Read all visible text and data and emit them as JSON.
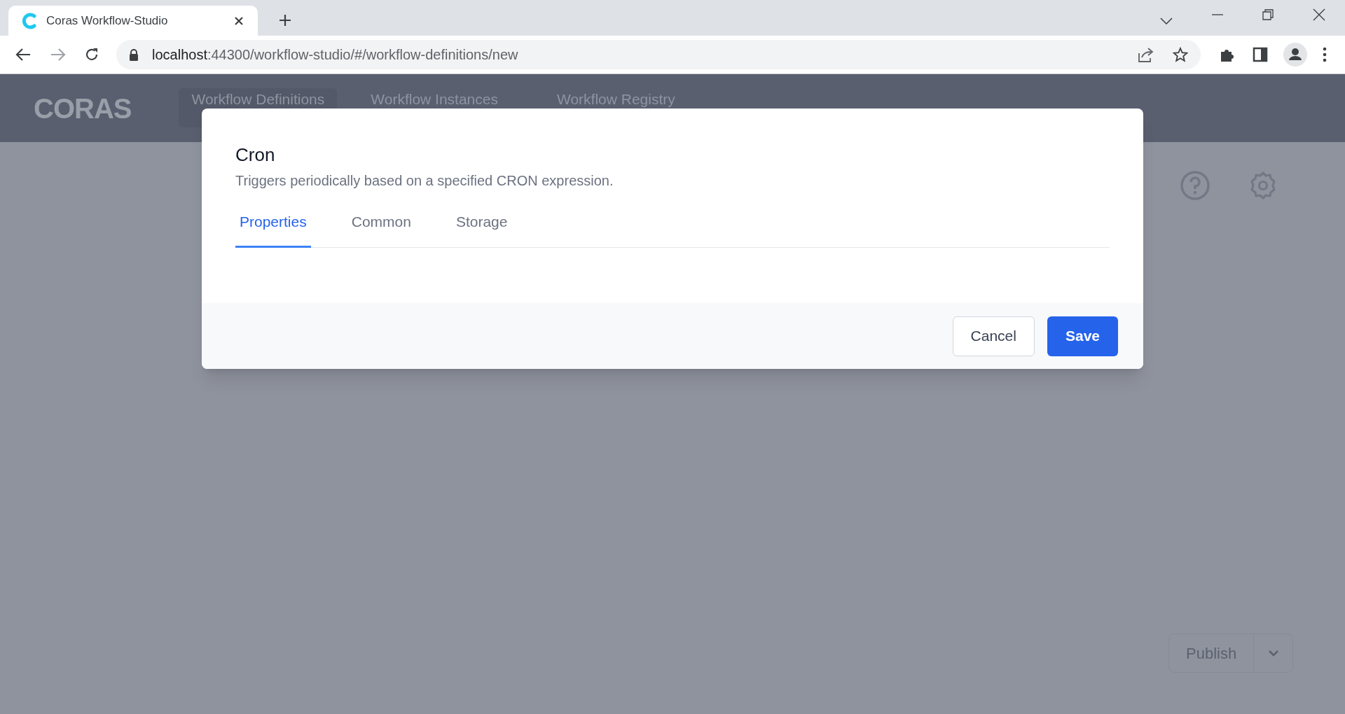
{
  "browser": {
    "tab_title": "Coras Workflow-Studio",
    "url_host": "localhost",
    "url_path": ":44300/workflow-studio/#/workflow-definitions/new"
  },
  "app": {
    "logo": "CORAS",
    "nav": [
      {
        "label": "Workflow Definitions",
        "selected": true
      },
      {
        "label": "Workflow Instances",
        "selected": false
      },
      {
        "label": "Workflow Registry",
        "selected": false
      }
    ],
    "publish_button": "Publish"
  },
  "dialog": {
    "title": "Cron",
    "description": "Triggers periodically based on a specified CRON expression.",
    "tabs": [
      {
        "label": "Properties",
        "selected": true
      },
      {
        "label": "Common",
        "selected": false
      },
      {
        "label": "Storage",
        "selected": false
      }
    ],
    "buttons": [
      {
        "label": "Cancel",
        "kind": "secondary"
      },
      {
        "label": "Save",
        "kind": "primary"
      }
    ]
  }
}
